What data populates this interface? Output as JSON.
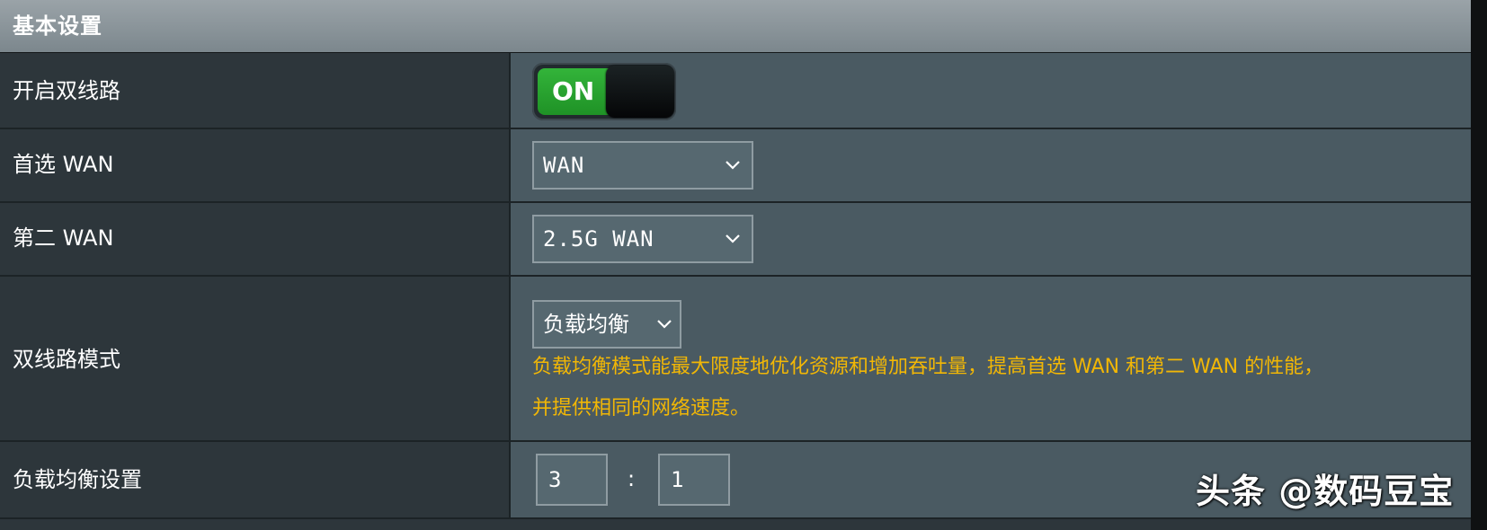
{
  "section": {
    "title": "基本设置"
  },
  "rows": {
    "dual_wan": {
      "label": "开启双线路",
      "toggle_state": "ON"
    },
    "primary_wan": {
      "label": "首选 WAN",
      "selected": "WAN"
    },
    "secondary_wan": {
      "label": "第二 WAN",
      "selected": "2.5G WAN"
    },
    "mode": {
      "label": "双线路模式",
      "selected": "负载均衡",
      "hint_line1": "负载均衡模式能最大限度地优化资源和增加吞吐量，提高首选 WAN 和第二 WAN 的性能，",
      "hint_line2": "并提供相同的网络速度。"
    },
    "load_balance": {
      "label": "负载均衡设置",
      "ratio_primary": "3",
      "separator": ":",
      "ratio_secondary": "1"
    }
  },
  "watermark": "头条 @数码豆宝",
  "colors": {
    "accent_on": "#2aa832",
    "hint": "#f2b705",
    "value_bg": "#4a5a62",
    "label_bg": "#2d363b"
  }
}
